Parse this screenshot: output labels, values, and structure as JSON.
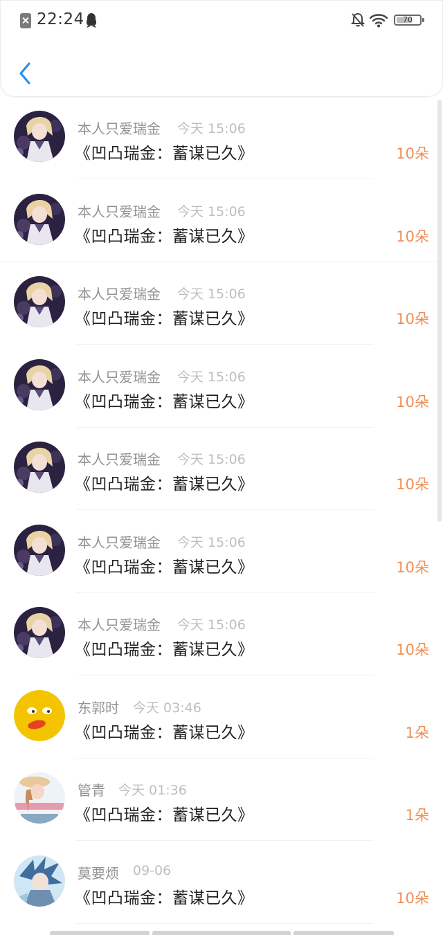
{
  "status_bar": {
    "time": "22:24",
    "battery": "70",
    "battery_level": 0.7,
    "icons": [
      "sim-off-icon",
      "qq-notification-icon",
      "mute-icon",
      "wifi-icon",
      "battery-icon"
    ]
  },
  "header": {
    "back_icon": "chevron-left-icon",
    "accent_color": "#2d8fe3"
  },
  "list": {
    "count_color": "#ef8e54",
    "items": [
      {
        "user": "本人只爱瑞金",
        "time": "今天 15:06",
        "title": "《凹凸瑞金：蓄谋已久》",
        "count": "10朵",
        "avatar": "anime-avatar"
      },
      {
        "user": "本人只爱瑞金",
        "time": "今天 15:06",
        "title": "《凹凸瑞金：蓄谋已久》",
        "count": "10朵",
        "avatar": "anime-avatar"
      },
      {
        "user": "本人只爱瑞金",
        "time": "今天 15:06",
        "title": "《凹凸瑞金：蓄谋已久》",
        "count": "10朵",
        "avatar": "anime-avatar"
      },
      {
        "user": "本人只爱瑞金",
        "time": "今天 15:06",
        "title": "《凹凸瑞金：蓄谋已久》",
        "count": "10朵",
        "avatar": "anime-avatar"
      },
      {
        "user": "本人只爱瑞金",
        "time": "今天 15:06",
        "title": "《凹凸瑞金：蓄谋已久》",
        "count": "10朵",
        "avatar": "anime-avatar"
      },
      {
        "user": "本人只爱瑞金",
        "time": "今天 15:06",
        "title": "《凹凸瑞金：蓄谋已久》",
        "count": "10朵",
        "avatar": "anime-avatar"
      },
      {
        "user": "本人只爱瑞金",
        "time": "今天 15:06",
        "title": "《凹凸瑞金：蓄谋已久》",
        "count": "10朵",
        "avatar": "anime-avatar"
      },
      {
        "user": "东郭时",
        "time": "今天 03:46",
        "title": "《凹凸瑞金：蓄谋已久》",
        "count": "1朵",
        "avatar": "emoji-avatar"
      },
      {
        "user": "管青",
        "time": "今天 01:36",
        "title": "《凹凸瑞金：蓄谋已久》",
        "count": "1朵",
        "avatar": "girl-avatar"
      },
      {
        "user": "莫要烦",
        "time": "09-06",
        "title": "《凹凸瑞金：蓄谋已久》",
        "count": "10朵",
        "avatar": "blue-anime-avatar"
      }
    ]
  }
}
